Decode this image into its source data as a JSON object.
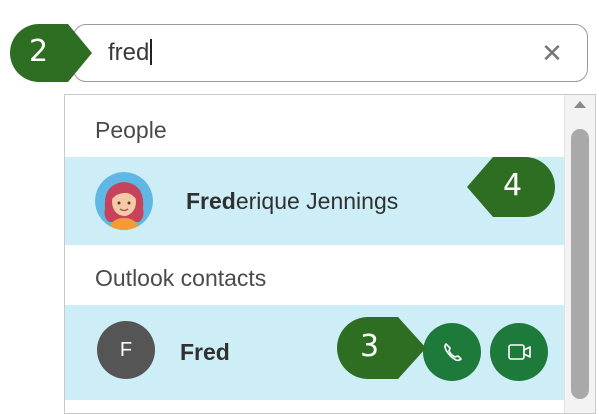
{
  "search": {
    "value": "fred"
  },
  "dropdown": {
    "sections": [
      {
        "header": "People",
        "item": {
          "name_match": "Fred",
          "name_rest": "erique Jennings"
        }
      },
      {
        "header": "Outlook contacts",
        "item": {
          "initial": "F",
          "name": "Fred"
        }
      }
    ]
  },
  "callouts": [
    "2",
    "4",
    "3"
  ],
  "icons": {
    "clear": "close-icon",
    "call": "phone-icon",
    "video": "video-camera-icon",
    "scroll_up": "chevron-up-icon"
  },
  "colors": {
    "callout_green": "#2d6e23",
    "action_green": "#1e7a3b",
    "highlight_row": "#cdeef7",
    "contact_avatar": "#555555"
  }
}
